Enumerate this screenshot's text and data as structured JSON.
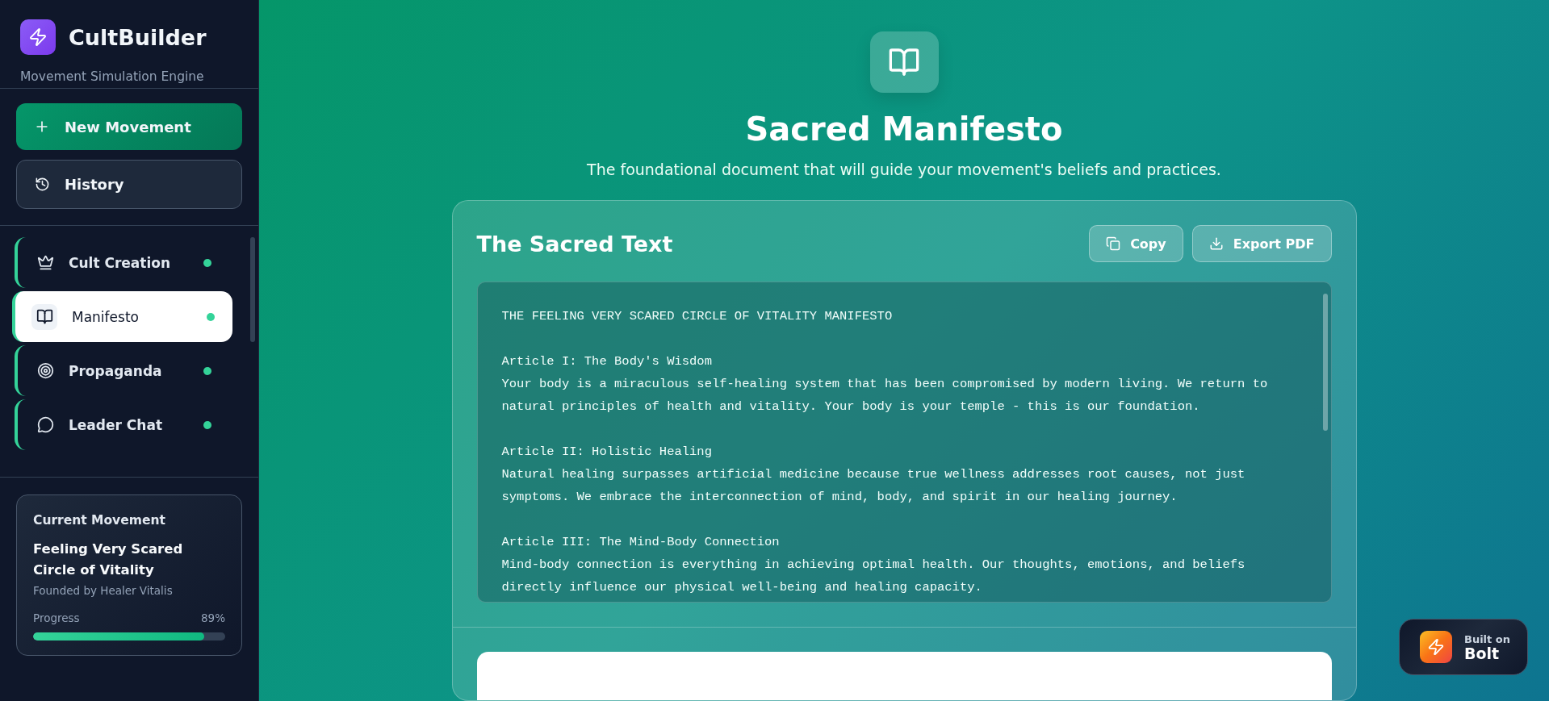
{
  "sidebar": {
    "brand": {
      "title": "CultBuilder",
      "subtitle": "Movement Simulation Engine"
    },
    "actions": [
      {
        "kind": "primary",
        "label": "New Movement"
      },
      {
        "kind": "history",
        "label": "History"
      }
    ],
    "nav": [
      {
        "kind": "crown",
        "label": "Cult Creation",
        "selected": false,
        "complete": true
      },
      {
        "kind": "book",
        "label": "Manifesto",
        "selected": true,
        "complete": true
      },
      {
        "kind": "target",
        "label": "Propaganda",
        "selected": false,
        "complete": true
      },
      {
        "kind": "chat",
        "label": "Leader Chat",
        "selected": false,
        "complete": true
      }
    ],
    "current": {
      "heading": "Current Movement",
      "name": "Feeling Very Scared Circle of Vitality",
      "founder": "Founded by Healer Vitalis",
      "progress_label": "Progress",
      "progress_reading": "89%",
      "level": 0.89
    }
  },
  "page": {
    "title": "Sacred Manifesto",
    "subtitle": "The foundational document that will guide your movement's beliefs and practices."
  },
  "card": {
    "title": "The Sacred Text",
    "buttons": [
      {
        "kind": "copy",
        "label": "Copy"
      },
      {
        "kind": "export",
        "label": "Export PDF"
      }
    ],
    "text": {
      "heading": "THE FEELING VERY SCARED CIRCLE OF VITALITY MANIFESTO",
      "articles": [
        {
          "title": "Article I: The Body's Wisdom",
          "body": "Your body is a miraculous self-healing system that has been compromised by modern living. We return to natural principles of health and vitality. Your body is your temple - this is our foundation."
        },
        {
          "title": "Article II: Holistic Healing",
          "body": "Natural healing surpasses artificial medicine because true wellness addresses root causes, not just symptoms. We embrace the interconnection of mind, body, and spirit in our healing journey."
        },
        {
          "title": "Article III: The Mind-Body Connection",
          "body": "Mind-body connection is everything in achieving optimal health. Our thoughts, emotions, and beliefs directly influence our physical well-being and healing capacity."
        }
      ]
    }
  },
  "badge": {
    "top": "Built on",
    "bottom": "Bolt"
  }
}
